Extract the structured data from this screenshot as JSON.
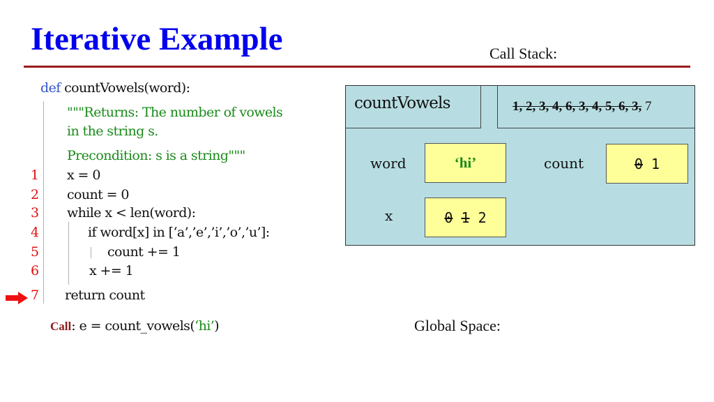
{
  "slide": {
    "title": "Iterative Example",
    "call_stack_label": "Call Stack:",
    "global_space_label": "Global Space:"
  },
  "code": {
    "def_keyword": "def",
    "signature": "countVowels(word):",
    "docstring": [
      "\"\"\"Returns: The number of vowels",
      "in the string s.",
      "Precondition: s is a string\"\"\""
    ],
    "lines": [
      {
        "number": "1",
        "text": "x = 0"
      },
      {
        "number": "2",
        "text": "count = 0"
      },
      {
        "number": "3",
        "text": "while x < len(word):"
      },
      {
        "number": "4",
        "text": "if word[x] in [‘a’,’e’,’i’,’o’,’u’]:"
      },
      {
        "number": "5",
        "text": "count += 1"
      },
      {
        "number": "6",
        "text": "x += 1"
      },
      {
        "number": "7",
        "text": "return count"
      }
    ],
    "current_line": "7",
    "current_line_indicator": "right-arrow-icon"
  },
  "call": {
    "keyword": "Call",
    "separator": ":",
    "prefix": " e = count_vowels(",
    "argument": "‘hi’",
    "suffix": ")"
  },
  "frame": {
    "name": "countVowels",
    "program_counter": {
      "crossed_out": "1, 2, 3, 4, 6, 3, 4, 5, 6, 3,",
      "current": "7"
    },
    "variables": [
      {
        "name": "word",
        "old_values": [],
        "value": "‘hi’"
      },
      {
        "name": "count",
        "old_values": [
          "0"
        ],
        "value": "1"
      },
      {
        "name": "x",
        "old_values": [
          "0",
          "1"
        ],
        "value": "2"
      }
    ]
  },
  "colors": {
    "title": "#0000ee",
    "rule": "#9b1b1b",
    "frame_bg": "#b7dde2",
    "var_box_bg": "#ffff99",
    "line_number": "#e01010",
    "docstring": "#1a8a1a",
    "keyword": "#3355cc"
  }
}
